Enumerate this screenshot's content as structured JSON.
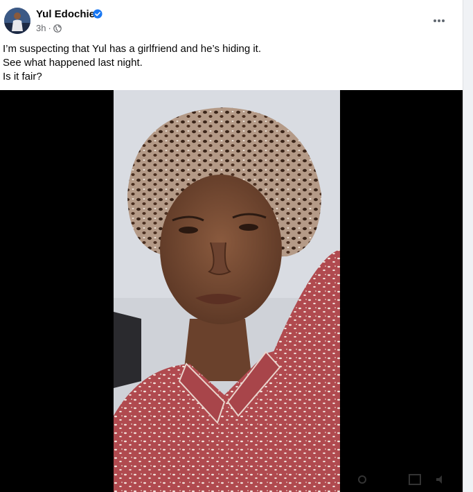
{
  "post": {
    "author": "Yul Edochie",
    "time": "3h",
    "separator": "·",
    "text_lines": [
      "I’m suspecting that Yul has a girlfriend and he’s hiding it.",
      "See what happened last night.",
      "Is it fair?"
    ]
  },
  "icons": {
    "verified": "verified-badge-icon",
    "audience": "globe-icon",
    "more": "more-options-icon"
  },
  "colors": {
    "verified_blue": "#1877f2",
    "meta_gray": "#65676b",
    "text": "#050505",
    "video_bg": "#000000",
    "pajama_red": "#b04a4f"
  }
}
